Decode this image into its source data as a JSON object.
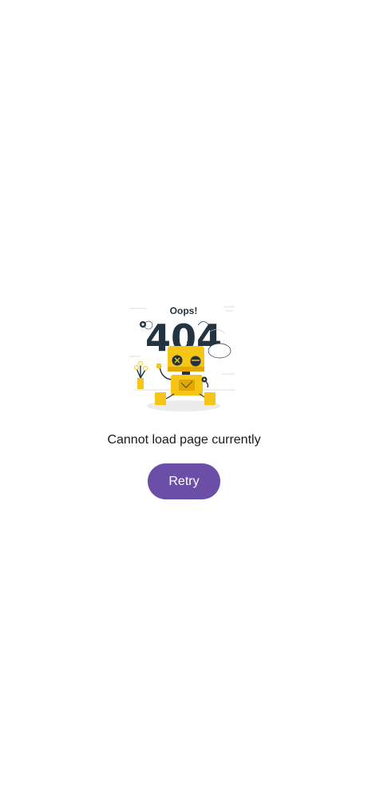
{
  "illustration": {
    "heading": "Oops!",
    "code": "404",
    "robot_color": "#F5C518",
    "ink_color": "#233440"
  },
  "message": "Cannot load page currently",
  "retry_label": "Retry",
  "accent_color": "#6A4EA8"
}
